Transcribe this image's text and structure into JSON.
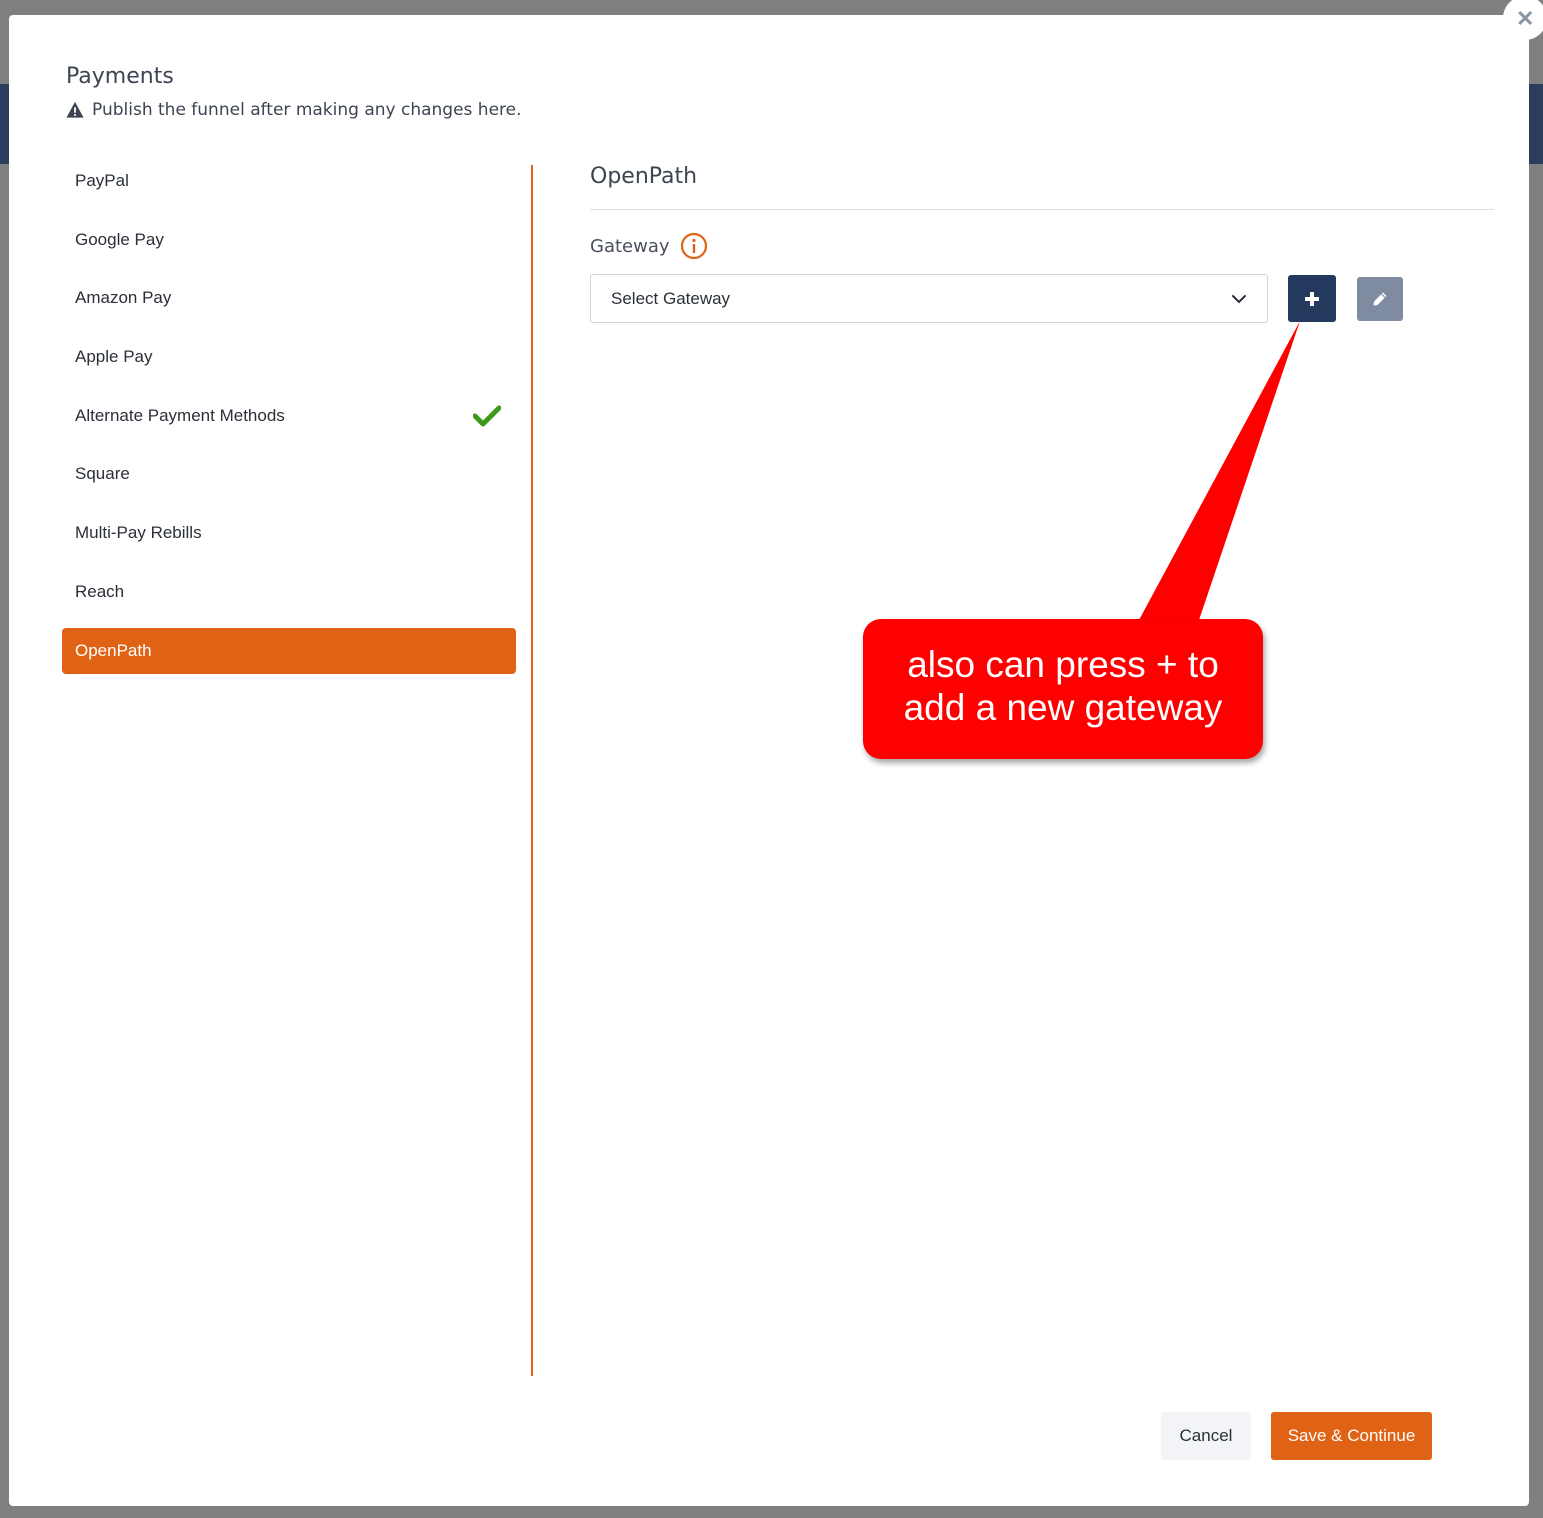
{
  "modal": {
    "title": "Payments",
    "note": "Publish the funnel after making any changes here.",
    "close_label": "✕"
  },
  "sidebar": {
    "items": [
      {
        "label": "PayPal",
        "checked": false,
        "active": false
      },
      {
        "label": "Google Pay",
        "checked": false,
        "active": false
      },
      {
        "label": "Amazon Pay",
        "checked": false,
        "active": false
      },
      {
        "label": "Apple Pay",
        "checked": false,
        "active": false
      },
      {
        "label": "Alternate Payment Methods",
        "checked": true,
        "active": false
      },
      {
        "label": "Square",
        "checked": false,
        "active": false
      },
      {
        "label": "Multi-Pay Rebills",
        "checked": false,
        "active": false
      },
      {
        "label": "Reach",
        "checked": false,
        "active": false
      },
      {
        "label": "OpenPath",
        "checked": false,
        "active": true
      }
    ]
  },
  "content": {
    "title": "OpenPath",
    "gateway_label": "Gateway",
    "select_value": "Select Gateway"
  },
  "callout": {
    "line1": "also can press + to",
    "line2": "add a new gateway"
  },
  "footer": {
    "cancel_label": "Cancel",
    "save_label": "Save & Continue"
  },
  "colors": {
    "accent": "#e06315",
    "navy": "#233a5e",
    "edit_gray": "#7f8ba0",
    "check_green": "#3d9a1a",
    "callout_red": "#ff0000"
  },
  "icons": [
    "warning-icon",
    "check-icon",
    "info-icon",
    "chevron-down-icon",
    "plus-icon",
    "pencil-icon",
    "close-icon"
  ]
}
